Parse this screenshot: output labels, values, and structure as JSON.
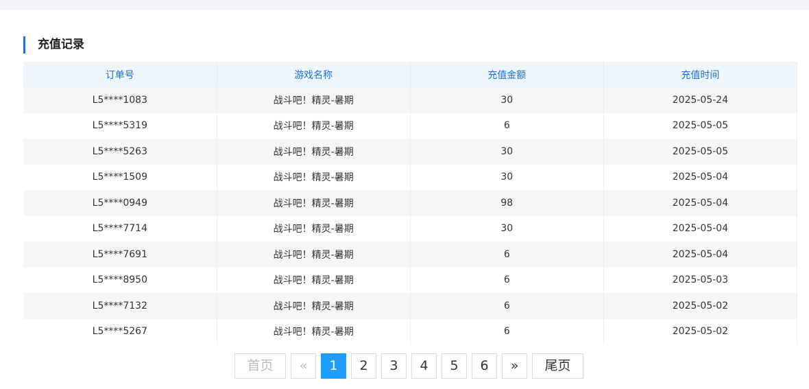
{
  "section": {
    "title": "充值记录"
  },
  "table": {
    "headers": [
      "订单号",
      "游戏名称",
      "充值金额",
      "充值时间"
    ],
    "rows": [
      [
        "L5****1083",
        "战斗吧！精灵-暑期",
        "30",
        "2025-05-24"
      ],
      [
        "L5****5319",
        "战斗吧！精灵-暑期",
        "6",
        "2025-05-05"
      ],
      [
        "L5****5263",
        "战斗吧！精灵-暑期",
        "30",
        "2025-05-05"
      ],
      [
        "L5****1509",
        "战斗吧！精灵-暑期",
        "30",
        "2025-05-04"
      ],
      [
        "L5****0949",
        "战斗吧！精灵-暑期",
        "98",
        "2025-05-04"
      ],
      [
        "L5****7714",
        "战斗吧！精灵-暑期",
        "30",
        "2025-05-04"
      ],
      [
        "L5****7691",
        "战斗吧！精灵-暑期",
        "6",
        "2025-05-04"
      ],
      [
        "L5****8950",
        "战斗吧！精灵-暑期",
        "6",
        "2025-05-03"
      ],
      [
        "L5****7132",
        "战斗吧！精灵-暑期",
        "6",
        "2025-05-02"
      ],
      [
        "L5****5267",
        "战斗吧！精灵-暑期",
        "6",
        "2025-05-02"
      ]
    ]
  },
  "pagination": {
    "first_label": "首页",
    "prev_label": "«",
    "pages": [
      "1",
      "2",
      "3",
      "4",
      "5",
      "6"
    ],
    "current_page": "1",
    "next_label": "»",
    "last_label": "尾页"
  },
  "colors": {
    "accent": "#1a6fd1",
    "active_page": "#1e9fff",
    "header_bg": "#eef6fd",
    "stripe_bg": "#f6f6f6"
  }
}
